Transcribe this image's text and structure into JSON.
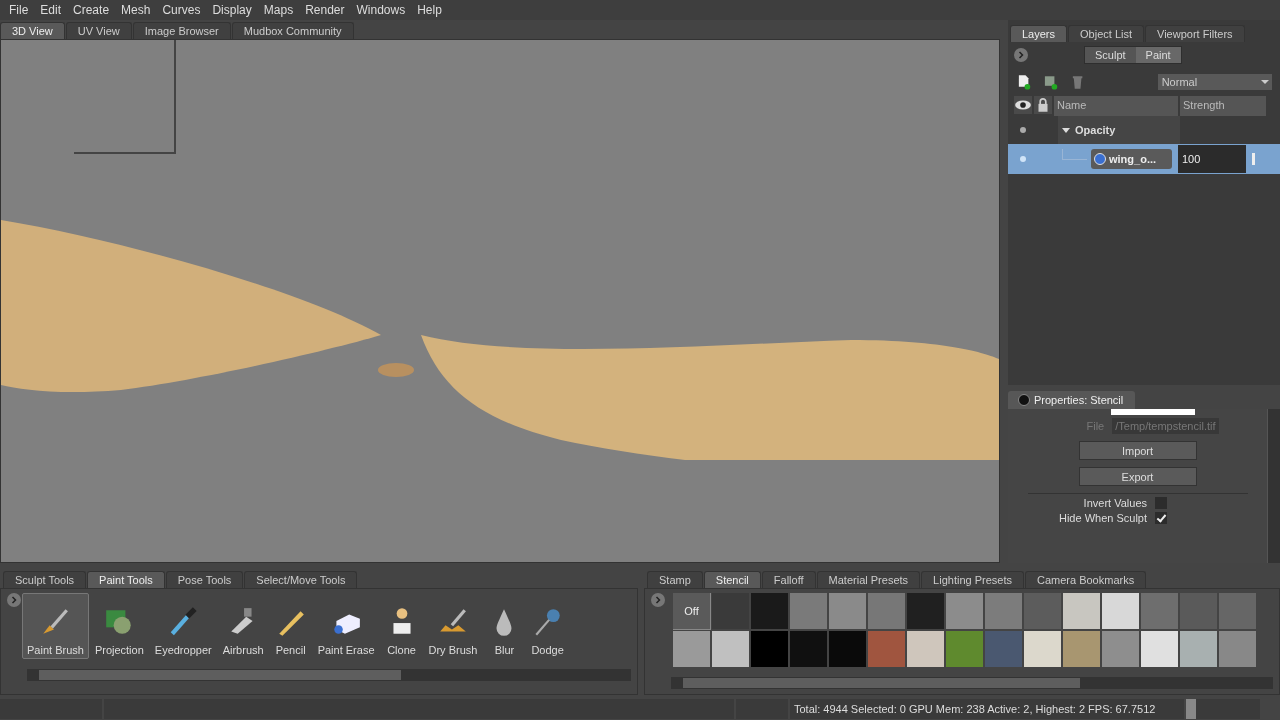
{
  "menu": [
    "File",
    "Edit",
    "Create",
    "Mesh",
    "Curves",
    "Display",
    "Maps",
    "Render",
    "Windows",
    "Help"
  ],
  "viewport_tabs": [
    {
      "label": "3D View",
      "selected": true
    },
    {
      "label": "UV View",
      "selected": false
    },
    {
      "label": "Image Browser",
      "selected": false
    },
    {
      "label": "Mudbox Community",
      "selected": false
    }
  ],
  "panel_tabs": [
    {
      "label": "Layers",
      "selected": true
    },
    {
      "label": "Object List",
      "selected": false
    },
    {
      "label": "Viewport Filters",
      "selected": false
    }
  ],
  "mode_toggle": [
    {
      "label": "Sculpt",
      "selected": false
    },
    {
      "label": "Paint",
      "selected": true
    }
  ],
  "blend_mode": "Normal",
  "layer_columns": [
    "Name",
    "Strength"
  ],
  "layers": [
    {
      "name": "Opacity",
      "visible": true,
      "expanded": true,
      "selected": false,
      "children": [
        {
          "name": "wing_o...",
          "strength": "100",
          "visible": true,
          "selected": true
        }
      ]
    }
  ],
  "properties": {
    "title": "Properties: Stencil",
    "file_label": "File",
    "file_value": "/Temp/tempstencil.tif",
    "buttons": [
      "Import",
      "Export"
    ],
    "options": [
      {
        "label": "Invert Values",
        "checked": false
      },
      {
        "label": "Hide When Sculpt",
        "checked": true
      }
    ]
  },
  "tool_tabs": [
    {
      "label": "Sculpt Tools",
      "selected": false
    },
    {
      "label": "Paint Tools",
      "selected": true
    },
    {
      "label": "Pose Tools",
      "selected": false
    },
    {
      "label": "Select/Move Tools",
      "selected": false
    }
  ],
  "tools": [
    {
      "label": "Paint Brush",
      "selected": true
    },
    {
      "label": "Projection",
      "selected": false
    },
    {
      "label": "Eyedropper",
      "selected": false
    },
    {
      "label": "Airbrush",
      "selected": false
    },
    {
      "label": "Pencil",
      "selected": false
    },
    {
      "label": "Paint Erase",
      "selected": false
    },
    {
      "label": "Clone",
      "selected": false
    },
    {
      "label": "Dry Brush",
      "selected": false
    },
    {
      "label": "Blur",
      "selected": false
    },
    {
      "label": "Dodge",
      "selected": false
    }
  ],
  "tray_tabs": [
    {
      "label": "Stamp",
      "selected": false
    },
    {
      "label": "Stencil",
      "selected": true
    },
    {
      "label": "Falloff",
      "selected": false
    },
    {
      "label": "Material Presets",
      "selected": false
    },
    {
      "label": "Lighting Presets",
      "selected": false
    },
    {
      "label": "Camera Bookmarks",
      "selected": false
    }
  ],
  "stencil_off": {
    "label": "Off",
    "selected": true
  },
  "stencils": [
    {
      "color": "#3a3a3a"
    },
    {
      "color": "#1a1a1a"
    },
    {
      "color": "#7a7a7a"
    },
    {
      "color": "#8a8a8a"
    },
    {
      "color": "#777777"
    },
    {
      "color": "#202020"
    },
    {
      "color": "#8c8c8c"
    },
    {
      "color": "#7c7c7c"
    },
    {
      "color": "#5c5c5c"
    },
    {
      "color": "#c8c6c0"
    },
    {
      "color": "#d8d8d8"
    },
    {
      "color": "#6e6e6e"
    },
    {
      "color": "#5a5a5a"
    },
    {
      "color": "#666666"
    },
    {
      "color": "#9a9a9a"
    },
    {
      "color": "#c0c0c0"
    },
    {
      "color": "#000000"
    },
    {
      "color": "#101010"
    },
    {
      "color": "#0a0a0a"
    },
    {
      "color": "#a0553f"
    },
    {
      "color": "#cfc6bc"
    },
    {
      "color": "#5f8a2e"
    },
    {
      "color": "#4a5870"
    },
    {
      "color": "#dcd8cc"
    },
    {
      "color": "#a89670"
    },
    {
      "color": "#8e8e8e"
    },
    {
      "color": "#e0e0e0"
    },
    {
      "color": "#a8b0b0"
    },
    {
      "color": "#888888"
    }
  ],
  "status": "Total: 4944  Selected: 0 GPU Mem: 238  Active: 2, Highest: 2  FPS: 67.7512"
}
